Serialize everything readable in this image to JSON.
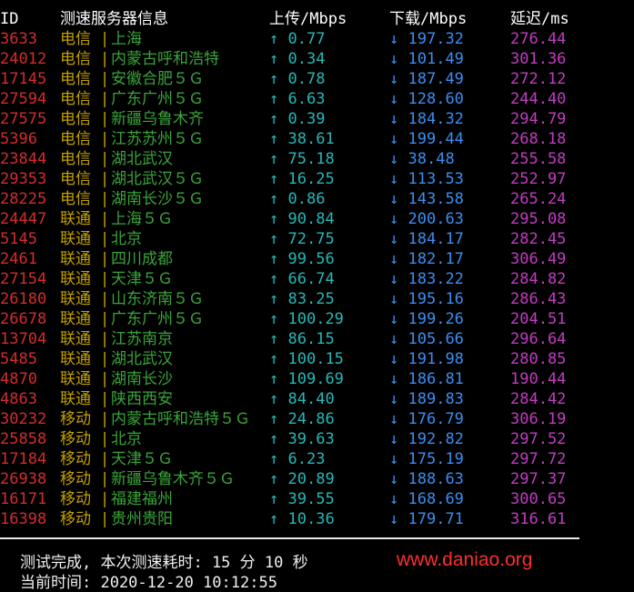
{
  "header": {
    "id": "ID",
    "server": "测速服务器信息",
    "upload": "上传/Mbps",
    "download": "下载/Mbps",
    "latency": "延迟/ms"
  },
  "up_arrow": "↑",
  "down_arrow": "↓",
  "separator": "|",
  "rows": [
    {
      "id": "3633",
      "isp": "电信",
      "loc": "上海",
      "up": "0.77",
      "down": "197.32",
      "ping": "276.44"
    },
    {
      "id": "24012",
      "isp": "电信",
      "loc": "内蒙古呼和浩特",
      "up": "0.34",
      "down": "101.49",
      "ping": "301.36"
    },
    {
      "id": "17145",
      "isp": "电信",
      "loc": "安徽合肥５Ｇ",
      "up": "0.78",
      "down": "187.49",
      "ping": "272.12"
    },
    {
      "id": "27594",
      "isp": "电信",
      "loc": "广东广州５Ｇ",
      "up": "6.63",
      "down": "128.60",
      "ping": "244.40"
    },
    {
      "id": "27575",
      "isp": "电信",
      "loc": "新疆乌鲁木齐",
      "up": "0.39",
      "down": "184.32",
      "ping": "294.79"
    },
    {
      "id": "5396",
      "isp": "电信",
      "loc": "江苏苏州５Ｇ",
      "up": "38.61",
      "down": "199.44",
      "ping": "268.18"
    },
    {
      "id": "23844",
      "isp": "电信",
      "loc": "湖北武汉",
      "up": "75.18",
      "down": "38.48",
      "ping": "255.58"
    },
    {
      "id": "29353",
      "isp": "电信",
      "loc": "湖北武汉５Ｇ",
      "up": "16.25",
      "down": "113.53",
      "ping": "252.97"
    },
    {
      "id": "28225",
      "isp": "电信",
      "loc": "湖南长沙５Ｇ",
      "up": "0.86",
      "down": "143.58",
      "ping": "265.24"
    },
    {
      "id": "24447",
      "isp": "联通",
      "loc": "上海５Ｇ",
      "up": "90.84",
      "down": "200.63",
      "ping": "295.08"
    },
    {
      "id": "5145",
      "isp": "联通",
      "loc": "北京",
      "up": "72.75",
      "down": "184.17",
      "ping": "282.45"
    },
    {
      "id": "2461",
      "isp": "联通",
      "loc": "四川成都",
      "up": "99.56",
      "down": "182.17",
      "ping": "306.49"
    },
    {
      "id": "27154",
      "isp": "联通",
      "loc": "天津５Ｇ",
      "up": "66.74",
      "down": "183.22",
      "ping": "284.82"
    },
    {
      "id": "26180",
      "isp": "联通",
      "loc": "山东济南５Ｇ",
      "up": "83.25",
      "down": "195.16",
      "ping": "286.43"
    },
    {
      "id": "26678",
      "isp": "联通",
      "loc": "广东广州５Ｇ",
      "up": "100.29",
      "down": "199.26",
      "ping": "204.51"
    },
    {
      "id": "13704",
      "isp": "联通",
      "loc": "江苏南京",
      "up": "86.15",
      "down": "105.66",
      "ping": "296.64"
    },
    {
      "id": "5485",
      "isp": "联通",
      "loc": "湖北武汉",
      "up": "100.15",
      "down": "191.98",
      "ping": "280.85"
    },
    {
      "id": "4870",
      "isp": "联通",
      "loc": "湖南长沙",
      "up": "109.69",
      "down": "186.81",
      "ping": "190.44"
    },
    {
      "id": "4863",
      "isp": "联通",
      "loc": "陕西西安",
      "up": "84.40",
      "down": "189.83",
      "ping": "284.42"
    },
    {
      "id": "30232",
      "isp": "移动",
      "loc": "内蒙古呼和浩特５Ｇ",
      "up": "24.86",
      "down": "176.79",
      "ping": "306.19"
    },
    {
      "id": "25858",
      "isp": "移动",
      "loc": "北京",
      "up": "39.63",
      "down": "192.82",
      "ping": "297.52"
    },
    {
      "id": "17184",
      "isp": "移动",
      "loc": "天津５Ｇ",
      "up": "6.23",
      "down": "175.19",
      "ping": "297.72"
    },
    {
      "id": "26938",
      "isp": "移动",
      "loc": "新疆乌鲁木齐５Ｇ",
      "up": "20.89",
      "down": "188.63",
      "ping": "297.37"
    },
    {
      "id": "16171",
      "isp": "移动",
      "loc": "福建福州",
      "up": "39.55",
      "down": "168.69",
      "ping": "300.65"
    },
    {
      "id": "16398",
      "isp": "移动",
      "loc": "贵州贵阳",
      "up": "10.36",
      "down": "179.71",
      "ping": "316.61"
    }
  ],
  "footer": {
    "summary": "测试完成, 本次测速耗时: 15 分 10 秒",
    "time": "当前时间: 2020-12-20 10:12:55",
    "brand": "www.daniao.org"
  },
  "colors": {
    "id": "#d42c2c",
    "isp": "#c2a000",
    "location": "#3aa43a",
    "upload": "#27b7b7",
    "download": "#3a8ef0",
    "latency": "#c23cc2",
    "brand": "#ff2d2d"
  }
}
